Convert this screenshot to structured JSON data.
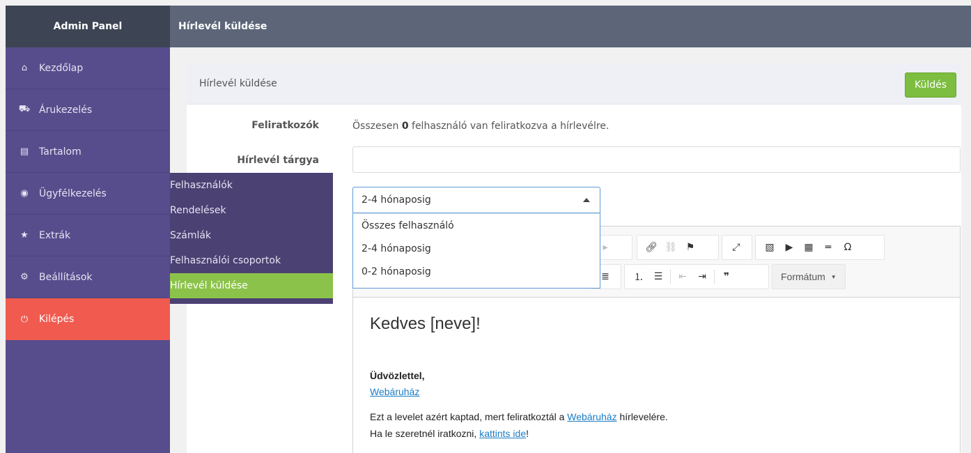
{
  "header": {
    "brand": "Admin Panel",
    "page_title": "Hírlevél küldése"
  },
  "sidebar": {
    "items": [
      {
        "label": "Kezdőlap",
        "icon": "home-icon",
        "glyph": "⌂"
      },
      {
        "label": "Árukezelés",
        "icon": "truck-icon",
        "glyph": "⛟"
      },
      {
        "label": "Tartalom",
        "icon": "file-icon",
        "glyph": "▤"
      },
      {
        "label": "Ügyfélkezelés",
        "icon": "user-circle-icon",
        "glyph": "◉"
      },
      {
        "label": "Extrák",
        "icon": "star-icon",
        "glyph": "★"
      },
      {
        "label": "Beállítások",
        "icon": "gear-icon",
        "glyph": "⚙"
      },
      {
        "label": "Kilépés",
        "icon": "power-icon",
        "glyph": "⏻"
      }
    ]
  },
  "submenu": {
    "items": [
      "Felhasználók",
      "Rendelések",
      "Számlák",
      "Felhasználói csoportok",
      "Hírlevél küldése"
    ]
  },
  "panel": {
    "title": "Hírlevél küldése",
    "send_label": "Küldés",
    "subscribers_label": "Feliratkozók",
    "subscribers_prefix": "Összesen",
    "subscribers_count": "0",
    "subscribers_suffix": "felhasználó van feliratkozva a hírlevélre.",
    "subject_label": "Hírlevél tárgya",
    "subject_value": ""
  },
  "audience_select": {
    "selected": "2-4 hónaposig",
    "options": [
      "Összes felhasználó",
      "2-4 hónaposig",
      "0-2 hónaposig"
    ]
  },
  "editor": {
    "format_label": "Formátum",
    "heading": "Kedves [neve]!",
    "greeting": "Üdvözlettel,",
    "shop_link": "Webáruház",
    "reason_prefix": "Ezt a levelet azért kaptad, mert feliratkoztál a",
    "reason_link": "Webáruház",
    "reason_suffix": "hírlevelére.",
    "unsub_prefix": "Ha le szeretnél iratkozni,",
    "unsub_link": "kattints ide",
    "unsub_suffix": "!"
  },
  "colors": {
    "accent_green": "#7dbd3f",
    "sidebar": "#574d8c",
    "logout": "#f05a4f",
    "topbar": "#5c6678"
  }
}
